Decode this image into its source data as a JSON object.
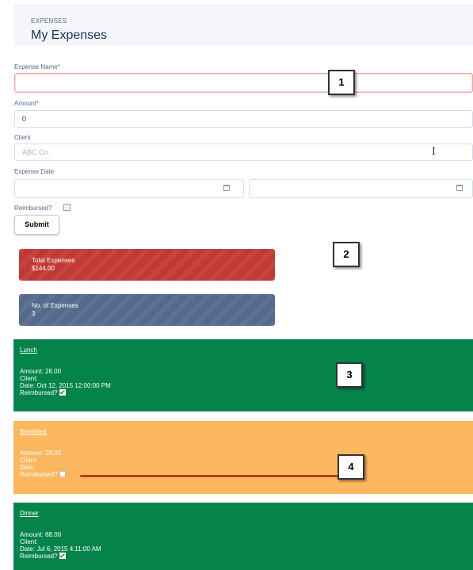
{
  "header": {
    "eyebrow": "EXPENSES",
    "title": "My Expenses"
  },
  "form": {
    "expense_name": {
      "label": "Expense Name*",
      "value": ""
    },
    "amount": {
      "label": "Amount*",
      "value": "0"
    },
    "client": {
      "label": "Client",
      "placeholder": "ABC Co."
    },
    "expense_date": {
      "label": "Expense Date"
    },
    "reimbursed": {
      "label": "Reimbursed?",
      "checked": false
    },
    "submit_label": "Submit"
  },
  "summary": {
    "total": {
      "label": "Total Expenses",
      "value": "$144.00",
      "color": "#c23934"
    },
    "count": {
      "label": "No. of Expenses",
      "value": "3",
      "color": "#54698d"
    }
  },
  "expenses": [
    {
      "name": "Lunch",
      "amount": "Amount: 28.00",
      "client": "Client:",
      "date": "Date: Oct 12, 2015 12:00:00 PM",
      "reimbursed_label": "Reimbursed?",
      "reimbursed": true,
      "color": "#04844b"
    },
    {
      "name": "Breakfast",
      "amount": "Amount: 28.00",
      "client": "Client:",
      "date": "Date:",
      "reimbursed_label": "Reimbursed?",
      "reimbursed": false,
      "color": "#fdb75e"
    },
    {
      "name": "Dinner",
      "amount": "Amount: 88.00",
      "client": "Client:",
      "date": "Date: Jul 6, 2015 4:11:00 AM",
      "reimbursed_label": "Reimbursed?",
      "reimbursed": true,
      "color": "#04844b"
    }
  ],
  "callouts": [
    "1",
    "2",
    "3",
    "4"
  ]
}
